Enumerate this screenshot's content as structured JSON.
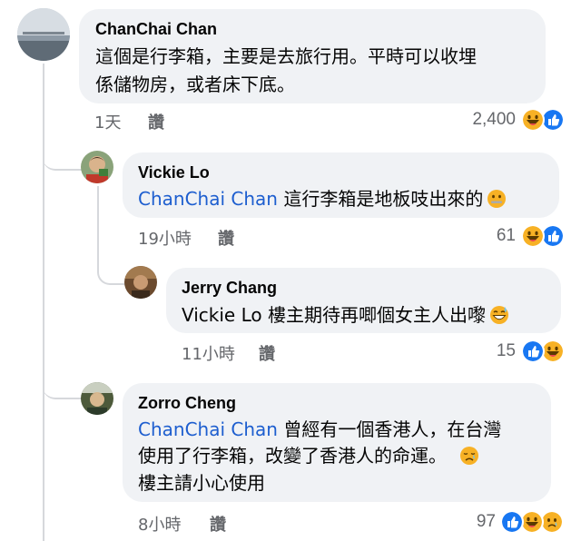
{
  "comments": [
    {
      "author": "ChanChai Chan",
      "lines": [
        "這個是行李箱，主要是去旅行用。平時可以收埋",
        "係儲物房，或者床下底。"
      ],
      "time": "1天",
      "like_label": "讚",
      "reaction_count": "2,400",
      "reactions": [
        "haha",
        "like"
      ]
    },
    {
      "author": "Vickie Lo",
      "mention": "ChanChai Chan",
      "text": "這行李箱是地板吱出來的",
      "inline_emoji": "zipper-mouth",
      "time": "19小時",
      "like_label": "讚",
      "reaction_count": "61",
      "reactions": [
        "haha",
        "like"
      ]
    },
    {
      "author": "Jerry Chang",
      "text": "Vickie Lo 樓主期待再唧個女主人出嚟",
      "inline_emoji": "grinning-sweat",
      "time": "11小時",
      "like_label": "讚",
      "reaction_count": "15",
      "reactions": [
        "like",
        "haha"
      ]
    },
    {
      "author": "Zorro Cheng",
      "mention": "ChanChai Chan",
      "line1": "曾經有一個香港人，在台灣",
      "line2": "使用了行李箱，改變了香港人的命運。",
      "line3": "樓主請小心使用",
      "inline_emoji": "crying",
      "time": "8小時",
      "like_label": "讚",
      "reaction_count": "97",
      "reactions": [
        "like",
        "haha",
        "sad"
      ]
    }
  ],
  "colors": {
    "bubble": "#f0f2f5",
    "mention": "#1d5ecf",
    "meta": "#65676b",
    "like_blue": "#1877f2",
    "haha_yellow": "#f7b125"
  }
}
